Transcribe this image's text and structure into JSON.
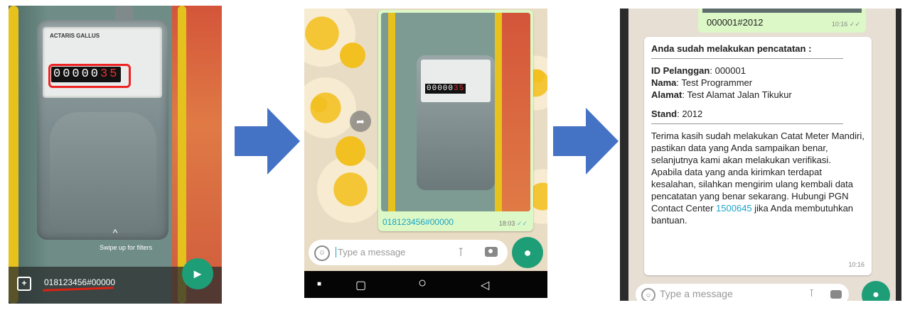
{
  "panel1": {
    "meter": {
      "brand": "ACTARIS GALLUS",
      "counter_black": "00000",
      "counter_red": "35"
    },
    "swipe_up_text": "Swipe up for filters",
    "caption_text": "018123456#00000",
    "icons": {
      "add": "add-media-icon",
      "send": "send-icon",
      "chevron": "chevron-up-icon"
    }
  },
  "panel2": {
    "photo_caption": "018123456#00000",
    "photo_time": "18:03",
    "input_placeholder": "Type a message",
    "icons": {
      "share": "share-icon",
      "emoji": "emoji-icon",
      "attach": "paperclip-icon",
      "camera": "camera-icon",
      "mic": "mic-icon"
    },
    "navbar": [
      "■",
      "▢",
      "○",
      "◁"
    ]
  },
  "panel3": {
    "top_caption": "000001#2012",
    "top_time": "10:16",
    "message": {
      "title": "Anda sudah melakukan pencatatan :",
      "id_label": "ID Pelanggan",
      "id_value": ": 000001",
      "nama_label": "Nama",
      "nama_value": ": Test Programmer",
      "alamat_label": "Alamat",
      "alamat_value": ": Test Alamat Jalan Tikukur",
      "stand_label": "Stand",
      "stand_value": ": 2012",
      "paragraph1": "Terima kasih sudah melakukan Catat Meter Mandiri, pastikan data yang Anda sampaikan benar, selanjutnya kami akan melakukan verifikasi.",
      "paragraph2_before": " Apabila data yang anda kirimkan terdapat kesalahan, silahkan mengirim ulang kembali data pencatatan yang benar sekarang. Hubungi PGN Contact Center ",
      "phone": "1500645",
      "paragraph2_after": " jika Anda membutuhkan bantuan.",
      "time": "10:16"
    },
    "input_placeholder": "Type a message"
  },
  "colors": {
    "whatsapp_green": "#1e9e77",
    "bubble_green": "#dcf8c6",
    "arrow_blue": "#4472c4",
    "link_blue": "#1aa3c9"
  }
}
